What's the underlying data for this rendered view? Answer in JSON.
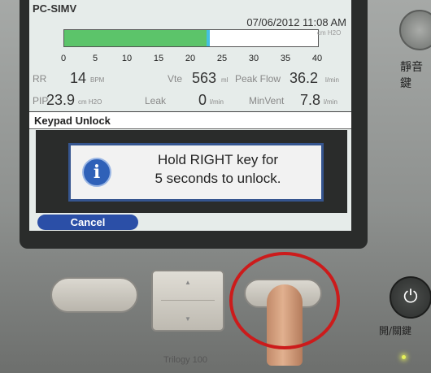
{
  "screen": {
    "mode": "PC-SIMV",
    "datetime": "07/06/2012 11:08 AM",
    "pressure_bar": {
      "fill_fraction": 0.56,
      "scale": [
        "0",
        "5",
        "10",
        "15",
        "20",
        "25",
        "30",
        "35",
        "40"
      ],
      "unit": "cm H2O"
    },
    "rr": {
      "label": "RR",
      "value": "14",
      "unit": "BPM"
    },
    "vte": {
      "label": "Vte",
      "value": "563",
      "unit": "ml"
    },
    "peak_flow": {
      "label": "Peak Flow",
      "value": "36.2",
      "unit": "l/min"
    },
    "pip": {
      "label": "PIP",
      "value": "23.9",
      "unit": "cm H2O"
    },
    "leak": {
      "label": "Leak",
      "value": "0",
      "unit": "l/min"
    },
    "min_vent": {
      "label": "MinVent",
      "value": "7.8",
      "unit": "l/min"
    },
    "keypad_title": "Keypad Unlock",
    "message_line1": "Hold RIGHT key for",
    "message_line2": "5 seconds to unlock.",
    "cancel_label": "Cancel"
  },
  "device": {
    "brand": "Trilogy 100",
    "alarm_silence_label": "靜音鍵",
    "power_label": "開/關鍵"
  },
  "icons": {
    "info": "info-icon",
    "power": "power-icon",
    "alarm_silence": "alarm-silence-icon"
  }
}
